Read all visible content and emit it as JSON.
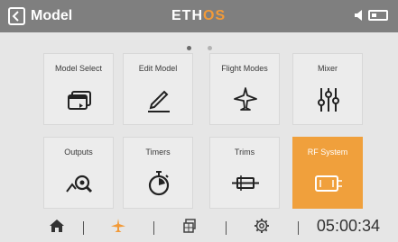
{
  "header": {
    "title": "Model",
    "logo_main": "ETH",
    "logo_accent": "OS"
  },
  "pager": {
    "pages": 2,
    "current": 1
  },
  "tiles": [
    {
      "label": "Model Select",
      "icon": "model-select-icon"
    },
    {
      "label": "Edit Model",
      "icon": "edit-pencil-icon"
    },
    {
      "label": "Flight Modes",
      "icon": "airplane-icon"
    },
    {
      "label": "Mixer",
      "icon": "mixer-sliders-icon"
    },
    {
      "label": "Outputs",
      "icon": "outputs-icon"
    },
    {
      "label": "Timers",
      "icon": "stopwatch-icon"
    },
    {
      "label": "Trims",
      "icon": "trims-icon"
    },
    {
      "label": "RF System",
      "icon": "rf-module-icon",
      "active": true
    }
  ],
  "nav": {
    "items": [
      "home-icon",
      "airplane-icon",
      "layers-icon",
      "gear-icon"
    ],
    "active": "airplane-icon",
    "clock": "05:00:34"
  },
  "colors": {
    "topbar": "#7f7f7f",
    "accent": "#f29a38",
    "tile_bg": "#ececec",
    "background": "#e6e6e6"
  }
}
